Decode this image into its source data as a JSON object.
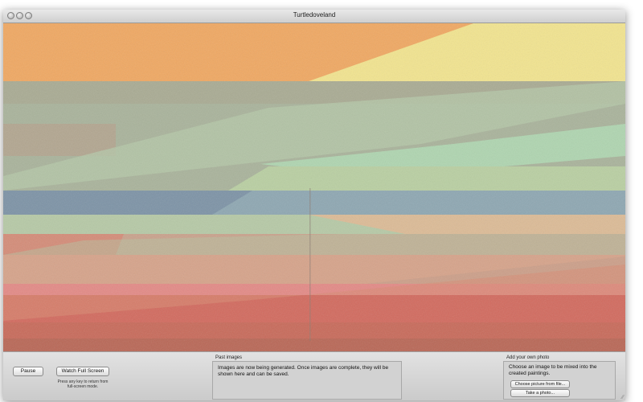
{
  "window": {
    "title": "Turtledoveland"
  },
  "controls": {
    "pause_label": "Pause",
    "fullscreen_label": "Watch Full Screen",
    "fullscreen_hint": "Press any key to return from full-screen mode."
  },
  "past_images": {
    "label": "Past images",
    "message": "Images are now being generated. Once images are complete, they will be shown here and can be saved."
  },
  "own_photo": {
    "label": "Add your own photo",
    "description": "Choose an image to be mixed into the created paintings.",
    "choose_file_label": "Choose picture from file...",
    "take_photo_label": "Take a photo..."
  },
  "colors": {
    "orange": "#f0a862",
    "yellow": "#f2e48f",
    "sage": "#a9b39b",
    "mint": "#b0dab4",
    "green": "#b9cfa2",
    "blue": "#7d93a6",
    "peach": "#e6b892",
    "rose": "#d9836f",
    "red": "#d26a5e",
    "pink": "#e38a86",
    "tan": "#d6a38a"
  }
}
